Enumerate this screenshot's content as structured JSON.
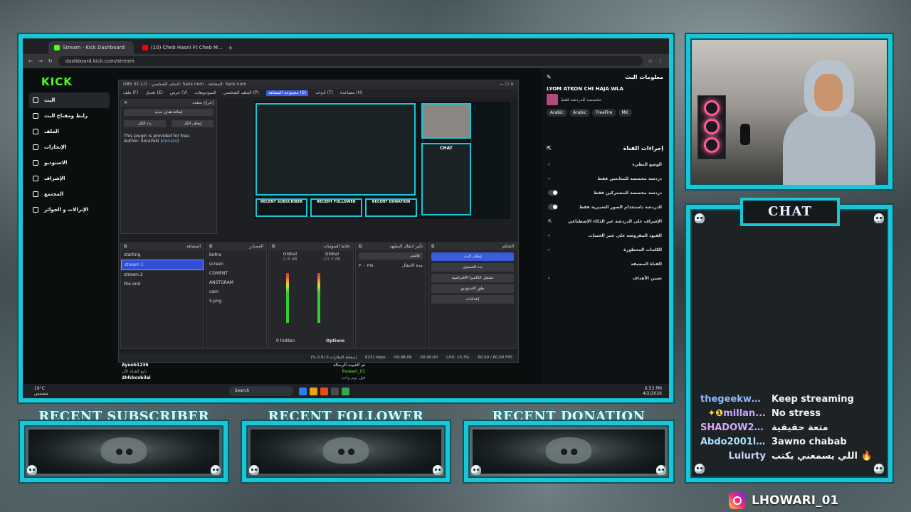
{
  "browser": {
    "tabs": [
      "Stream - Kick Dashboard",
      "(10) Cheb Hasni Ft Cheb M..."
    ],
    "url": "dashboard.kick.com/stream"
  },
  "kick": {
    "logo": "KICK",
    "nav": [
      "البث",
      "رابط ومفتاح البث",
      "الملف",
      "الإنجازات",
      "الاستوديو",
      "الإشراف",
      "المجتمع",
      "الإنزالات و الجوائز"
    ],
    "active_index": 0
  },
  "obs": {
    "title": "OBS 32.1.0 - الملف الشخصي: Sans nom - المشاهد: Sans nom",
    "menu": [
      "ملف (F)",
      "تعديل (E)",
      "عرض (V)",
      "السوديوهات",
      "الملف الشخصي (P)",
      "مجموعة المشاهد (S)",
      "أدوات (T)",
      "مساعدة (H)"
    ],
    "plugin_dock": {
      "title": "إخراج متعدد",
      "add_btn": "إضافة هدف جديد",
      "start_all": "بدء الكل",
      "stop_all": "إيقاف الكل",
      "note": "This plugin is provided for free.",
      "author": "Author: SoraYuki (",
      "donate": "donate",
      ")": ")"
    },
    "scenes": {
      "title": "المشاهد",
      "items": [
        "starting",
        "stream 1",
        "stream 2",
        "the end"
      ],
      "selected": 1
    },
    "sources": {
      "title": "المصادر",
      "items": [
        "botnx",
        "screen",
        "COMENT",
        "ANSTGRAM",
        "cam",
        "5.png"
      ]
    },
    "mixer": {
      "title": "خلاط الصوتيات",
      "ch1": "Global",
      "ch2": "Global",
      "db1": "-2.6 dB",
      "db2": "-10.3 dB",
      "hidden": "0 hidden",
      "options": "Options"
    },
    "transitions": {
      "title": "تأثير انتقال المشهد",
      "type": "تلاشي",
      "duration_label": "مدة الانتقال",
      "duration": "٣٠٠ ms"
    },
    "controls": {
      "title": "التحكم",
      "buttons": [
        "إيقاف البث",
        "بدء التسجيل",
        "تشغيل الكاميرا الافتراضية",
        "طور الاستوديو",
        "إعدادات"
      ]
    },
    "status": {
      "bitrate": "6231 kbps",
      "time1": "00:08:06",
      "time2": "00:00:00",
      "cpu": "CPU: 10.3%",
      "fps": "60.00 / 60.00 FPS",
      "dropped": "إسقاط الإطارات 0 (0.0 %)"
    }
  },
  "preview": {
    "recent": [
      "RECENT SUBSCRIBER",
      "RECENT FOLLOWER",
      "RECENT DONATION"
    ],
    "chat": "CHAT"
  },
  "right_panel": {
    "stream_info_title": "معلومات البث",
    "stream_title": "LYOM ATKON CHI HAJA WLA",
    "category": "مخصصة للدردشة فقط",
    "tags": [
      "Arabic",
      "Arabic",
      "FreeFire",
      "MK"
    ],
    "quick_actions_title": "إجراءات القناة",
    "rows": [
      "الوضع البطيء",
      "دردشة مخصصة للمتابعين فقط",
      "دردشة مخصصة للمشتركين فقط",
      "الدردشة باستخدام الصور التعبيرية فقط",
      "الإشراف على الدردشة عبر الذكاء الاصطناعي",
      "القيود المفروضة على عمر الحساب",
      "الكلمات المحظورة",
      "القناة المضيفة",
      "تعيين الأهداف"
    ],
    "follower_sub": "فوري"
  },
  "activity": {
    "user1": "Ayuob1236",
    "user1_sub": "تابع القناة الآن",
    "user2": "2hfckcxbilal",
    "event": "تم التثبيت الرسالة",
    "event_user": "lhowari_01",
    "time1": "قبل 10 ساعة",
    "time2": "قبل يوم واحد"
  },
  "taskbar": {
    "temp": "19°C",
    "weather": "مشمس",
    "search": "Search",
    "time": "6:53 PM",
    "date": "4/2/2026"
  },
  "overlay": {
    "recent": [
      "RECENT SUBSCRIBER",
      "RECENT FOLLOWER",
      "RECENT DONATION"
    ],
    "chat_title": "CHAT",
    "chat": [
      {
        "name": "thegeekwa...",
        "msg": "Keep streaming",
        "color": "#8fb8ff"
      },
      {
        "name": "millan...",
        "msg": "No stress",
        "color": "#c9a6ff",
        "badge": "✦❶"
      },
      {
        "name": "SHADOW21_1",
        "msg": "متعة حقيقية",
        "color": "#d8a8ff"
      },
      {
        "name": "Abdo2001l...",
        "msg": "3awno chabab",
        "color": "#a8e0ff"
      },
      {
        "name": "Lulurty",
        "msg": "اللي يسمعني يكتب 🔥",
        "color": "#c8d6ff"
      }
    ],
    "social": "LHOWARI_01"
  },
  "colors": {
    "accent": "#19c6d6",
    "kick_green": "#53fc18",
    "obs_blue": "#3b5bdb"
  }
}
